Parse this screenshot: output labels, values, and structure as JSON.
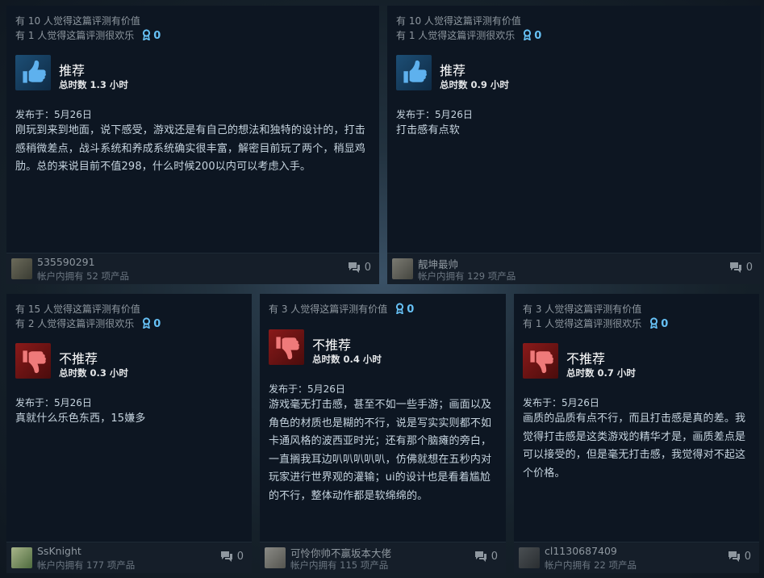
{
  "reviews": [
    {
      "helpful": "有 10 人觉得这篇评测有价值",
      "funny": "有 1 人觉得这篇评测很欢乐",
      "awards": "0",
      "verdict": "推荐",
      "hours": "总时数 1.3 小时",
      "posted": "发布于：5月26日",
      "text": "刚玩到来到地面，说下感受，游戏还是有自己的想法和独特的设计的，打击感稍微差点，战斗系统和养成系统确实很丰富，解密目前玩了两个，稍显鸡肋。总的来说目前不值298，什么时候200以内可以考虑入手。",
      "username": "535590291",
      "owned": "帐户内拥有 52 项产品",
      "comments": "0"
    },
    {
      "helpful": "有 10 人觉得这篇评测有价值",
      "funny": "有 1 人觉得这篇评测很欢乐",
      "awards": "0",
      "verdict": "推荐",
      "hours": "总时数 0.9 小时",
      "posted": "发布于：5月26日",
      "text": "打击感有点软",
      "username": "靓坤最帅",
      "owned": "帐户内拥有 129 项产品",
      "comments": "0"
    },
    {
      "helpful": "有 15 人觉得这篇评测有价值",
      "funny": "有 2 人觉得这篇评测很欢乐",
      "awards": "0",
      "verdict": "不推荐",
      "hours": "总时数 0.3 小时",
      "posted": "发布于：5月26日",
      "text": "真就什么乐色东西，15嫌多",
      "username": "SsKnight",
      "owned": "帐户内拥有 177 项产品",
      "comments": "0"
    },
    {
      "helpful": "有 3 人觉得这篇评测有价值",
      "funny": "",
      "awards": "0",
      "verdict": "不推荐",
      "hours": "总时数 0.4 小时",
      "posted": "发布于：5月26日",
      "text": "游戏毫无打击感，甚至不如一些手游；画面以及角色的材质也是糊的不行，说是写实实则都不如卡通风格的波西亚时光；还有那个脑瘫的旁白，一直搁我耳边叭叭叭叭叭，仿佛就想在五秒内对玩家进行世界观的灌输；ui的设计也是看着尴尬的不行，整体动作都是软绵绵的。",
      "username": "可怜你帅不赢坂本大佬",
      "owned": "帐户内拥有 115 项产品",
      "comments": "0"
    },
    {
      "helpful": "有 3 人觉得这篇评测有价值",
      "funny": "有 1 人觉得这篇评测很欢乐",
      "awards": "0",
      "verdict": "不推荐",
      "hours": "总时数 0.7 小时",
      "posted": "发布于：5月26日",
      "text": "画质的品质有点不行，而且打击感是真的差。我觉得打击感是这类游戏的精华才是，画质差点是可以接受的，但是毫无打击感，我觉得对不起这个价格。",
      "username": "cl1130687409",
      "owned": "帐户内拥有 22 项产品",
      "comments": "0"
    }
  ],
  "colors": {
    "card_bg": "#0d1622",
    "footer_bg": "#151e29",
    "text": "#c6d4df",
    "muted": "#8f98a0",
    "award": "#66c0f4",
    "recommended": "#1c4e75",
    "not_recommended": "#8a1a1a"
  },
  "icons": {
    "recommended": "thumbs-up-icon",
    "not_recommended": "thumbs-down-icon",
    "award": "award-icon",
    "comments": "comment-icon"
  }
}
